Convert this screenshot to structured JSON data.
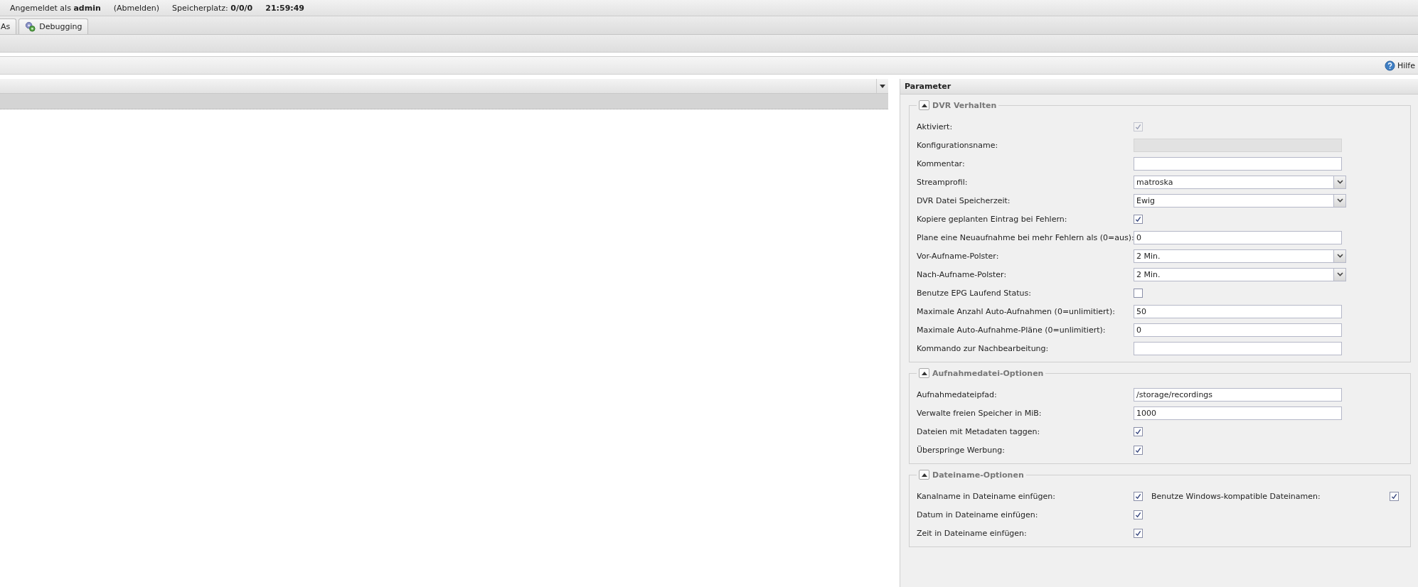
{
  "header": {
    "user": "Angemeldet als **admin**",
    "logout": "(Abmelden)",
    "storage": "Speicherplatz: **0/0/0**",
    "time": "21:59:49"
  },
  "tabs": [
    {
      "label": "As",
      "icon": false,
      "selected": false
    },
    {
      "label": "Debugging",
      "icon": true,
      "selected": false
    }
  ],
  "toolbar": {
    "help": "Hilfe"
  },
  "parameter_panel": {
    "title": "Parameter",
    "sections": [
      {
        "title": "DVR Verhalten",
        "expanded": true,
        "rows": [
          {
            "label": "Aktiviert:",
            "kind": "checkbox",
            "checked": true,
            "disabled": true
          },
          {
            "label": "Konfigurationsname:",
            "kind": "text",
            "disabled": true
          },
          {
            "label": "Kommentar:",
            "kind": "text",
            "disabled": false
          },
          {
            "label": "Streamprofil:",
            "kind": "select",
            "value": "matroska"
          },
          {
            "label": "DVR Datei Speicherzeit:",
            "kind": "select",
            "value": "Ewig"
          },
          {
            "label": "Kopiere geplanten Eintrag bei Fehlern:",
            "kind": "checkbox",
            "checked": true,
            "disabled": false
          },
          {
            "label": "Plane eine Neuaufnahme bei mehr Fehlern als (0=aus):",
            "kind": "text",
            "value": "0",
            "disabled": false
          },
          {
            "label": "Vor-Aufname-Polster:",
            "kind": "select",
            "value": "2 Min."
          },
          {
            "label": "Nach-Aufname-Polster:",
            "kind": "select",
            "value": "2 Min."
          },
          {
            "label": "Benutze EPG Laufend Status:",
            "kind": "checkbox",
            "checked": false,
            "disabled": false
          },
          {
            "label": "Maximale Anzahl Auto-Aufnahmen (0=unlimitiert):",
            "kind": "text",
            "value": "50",
            "disabled": false
          },
          {
            "label": "Maximale Auto-Aufnahme-Pläne (0=unlimitiert):",
            "kind": "text",
            "value": "0",
            "disabled": false
          },
          {
            "label": "Kommando zur Nachbearbeitung:",
            "kind": "text",
            "disabled": false
          }
        ]
      },
      {
        "title": "Aufnahmedatei-Optionen",
        "expanded": true,
        "rows": [
          {
            "label": "Aufnahmedateipfad:",
            "kind": "text",
            "value": "/storage/recordings",
            "disabled": false
          },
          {
            "label": "Verwalte freien Speicher in MiB:",
            "kind": "text",
            "value": "1000",
            "disabled": false
          },
          {
            "label": "Dateien mit Metadaten taggen:",
            "kind": "checkbox",
            "checked": true,
            "disabled": false
          },
          {
            "label": "Überspringe Werbung:",
            "kind": "checkbox",
            "checked": true,
            "disabled": false
          }
        ]
      },
      {
        "title": "Dateiname-Optionen",
        "expanded": true,
        "rows": [
          {
            "label": "Kanalname in Dateiname einfügen:",
            "kind": "checkbox",
            "checked": true,
            "disabled": false,
            "extra": {
              "label": "Benutze Windows-kompatible Dateinamen:",
              "checked": true
            }
          },
          {
            "label": "Datum in Dateiname einfügen:",
            "kind": "checkbox",
            "checked": true,
            "disabled": false
          },
          {
            "label": "Zeit in Dateiname einfügen:",
            "kind": "checkbox",
            "checked": true,
            "disabled": false
          }
        ]
      }
    ]
  }
}
